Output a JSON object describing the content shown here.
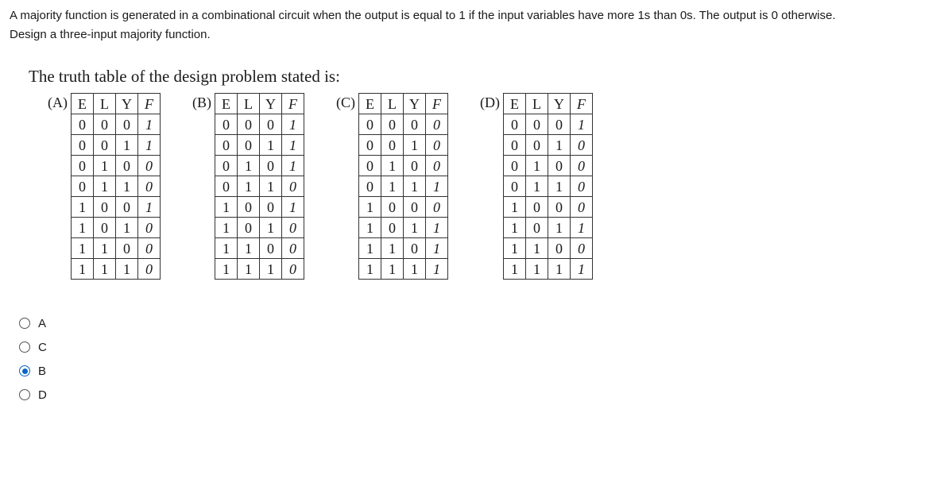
{
  "question": {
    "line1": "A majority function is generated in a combinational circuit when the output is equal to 1 if the input variables have more 1s than 0s. The output is 0 otherwise.",
    "line2": "Design a three-input majority function."
  },
  "heading": "The truth table of the design problem stated is:",
  "headers": [
    "E",
    "L",
    "Y",
    "F"
  ],
  "tables": {
    "A": {
      "label": "(A)",
      "rows": [
        [
          "0",
          "0",
          "0",
          "1"
        ],
        [
          "0",
          "0",
          "1",
          "1"
        ],
        [
          "0",
          "1",
          "0",
          "0"
        ],
        [
          "0",
          "1",
          "1",
          "0"
        ],
        [
          "1",
          "0",
          "0",
          "1"
        ],
        [
          "1",
          "0",
          "1",
          "0"
        ],
        [
          "1",
          "1",
          "0",
          "0"
        ],
        [
          "1",
          "1",
          "1",
          "0"
        ]
      ]
    },
    "B": {
      "label": "(B)",
      "rows": [
        [
          "0",
          "0",
          "0",
          "1"
        ],
        [
          "0",
          "0",
          "1",
          "1"
        ],
        [
          "0",
          "1",
          "0",
          "1"
        ],
        [
          "0",
          "1",
          "1",
          "0"
        ],
        [
          "1",
          "0",
          "0",
          "1"
        ],
        [
          "1",
          "0",
          "1",
          "0"
        ],
        [
          "1",
          "1",
          "0",
          "0"
        ],
        [
          "1",
          "1",
          "1",
          "0"
        ]
      ]
    },
    "C": {
      "label": "(C)",
      "rows": [
        [
          "0",
          "0",
          "0",
          "0"
        ],
        [
          "0",
          "0",
          "1",
          "0"
        ],
        [
          "0",
          "1",
          "0",
          "0"
        ],
        [
          "0",
          "1",
          "1",
          "1"
        ],
        [
          "1",
          "0",
          "0",
          "0"
        ],
        [
          "1",
          "0",
          "1",
          "1"
        ],
        [
          "1",
          "1",
          "0",
          "1"
        ],
        [
          "1",
          "1",
          "1",
          "1"
        ]
      ]
    },
    "D": {
      "label": "(D)",
      "rows": [
        [
          "0",
          "0",
          "0",
          "1"
        ],
        [
          "0",
          "0",
          "1",
          "0"
        ],
        [
          "0",
          "1",
          "0",
          "0"
        ],
        [
          "0",
          "1",
          "1",
          "0"
        ],
        [
          "1",
          "0",
          "0",
          "0"
        ],
        [
          "1",
          "0",
          "1",
          "1"
        ],
        [
          "1",
          "1",
          "0",
          "0"
        ],
        [
          "1",
          "1",
          "1",
          "1"
        ]
      ]
    }
  },
  "options": [
    {
      "value": "A",
      "label": "A",
      "selected": false
    },
    {
      "value": "C",
      "label": "C",
      "selected": false
    },
    {
      "value": "B",
      "label": "B",
      "selected": true
    },
    {
      "value": "D",
      "label": "D",
      "selected": false
    }
  ]
}
